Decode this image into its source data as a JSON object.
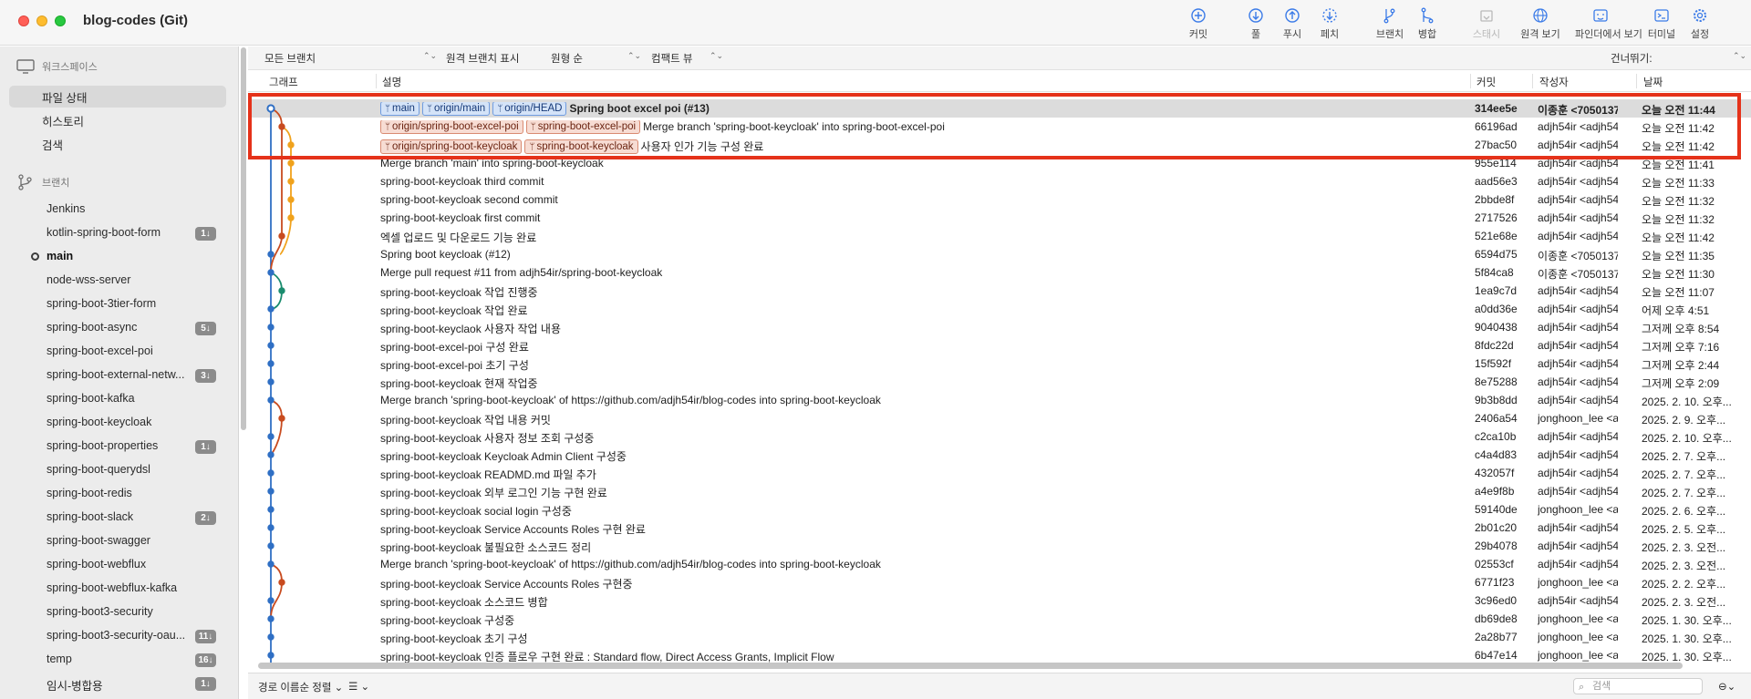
{
  "window": {
    "title": "blog-codes (Git)"
  },
  "toolbar": [
    {
      "label": "커밋",
      "icon": "plus-circle-icon",
      "disabled": false
    },
    {
      "label": "풀",
      "icon": "arrow-down-circle-icon",
      "disabled": false
    },
    {
      "label": "푸시",
      "icon": "arrow-up-circle-icon",
      "disabled": false
    },
    {
      "label": "페치",
      "icon": "arrow-down-dashed-circle-icon",
      "disabled": false
    },
    {
      "label": "브랜치",
      "icon": "branch-icon",
      "disabled": false
    },
    {
      "label": "병합",
      "icon": "merge-icon",
      "disabled": false
    },
    {
      "label": "스태시",
      "icon": "stash-icon",
      "disabled": true
    },
    {
      "label": "원격 보기",
      "icon": "globe-icon",
      "disabled": false
    },
    {
      "label": "파인더에서 보기",
      "icon": "finder-icon",
      "disabled": false
    },
    {
      "label": "터미널",
      "icon": "terminal-icon",
      "disabled": false
    },
    {
      "label": "설정",
      "icon": "gear-icon",
      "disabled": false
    }
  ],
  "sidebar": {
    "workspace_label": "워크스페이스",
    "workspace_items": [
      "파일 상태",
      "히스토리",
      "검색"
    ],
    "branches_label": "브랜치",
    "branches": [
      {
        "name": "Jenkins",
        "badge": ""
      },
      {
        "name": "kotlin-spring-boot-form",
        "badge": "1↓"
      },
      {
        "name": "main",
        "badge": "",
        "current": true
      },
      {
        "name": "node-wss-server",
        "badge": ""
      },
      {
        "name": "spring-boot-3tier-form",
        "badge": ""
      },
      {
        "name": "spring-boot-async",
        "badge": "5↓"
      },
      {
        "name": "spring-boot-excel-poi",
        "badge": ""
      },
      {
        "name": "spring-boot-external-netw...",
        "badge": "3↓"
      },
      {
        "name": "spring-boot-kafka",
        "badge": ""
      },
      {
        "name": "spring-boot-keycloak",
        "badge": ""
      },
      {
        "name": "spring-boot-properties",
        "badge": "1↓"
      },
      {
        "name": "spring-boot-querydsl",
        "badge": ""
      },
      {
        "name": "spring-boot-redis",
        "badge": ""
      },
      {
        "name": "spring-boot-slack",
        "badge": "2↓"
      },
      {
        "name": "spring-boot-swagger",
        "badge": ""
      },
      {
        "name": "spring-boot-webflux",
        "badge": ""
      },
      {
        "name": "spring-boot-webflux-kafka",
        "badge": ""
      },
      {
        "name": "spring-boot3-security",
        "badge": ""
      },
      {
        "name": "spring-boot3-security-oau...",
        "badge": "11↓"
      },
      {
        "name": "temp",
        "badge": "16↓"
      },
      {
        "name": "임시-병합용",
        "badge": "1↓"
      }
    ]
  },
  "filters": {
    "branches": "모든 브랜치",
    "remote": "원격 브랜치 표시",
    "order": "원형 순",
    "view": "컴팩트 뷰",
    "skip": "건너뛰기:"
  },
  "columns": {
    "graph": "그래프",
    "desc": "설명",
    "commit": "커밋",
    "author": "작성자",
    "date": "날짜"
  },
  "commits": [
    {
      "tags": [
        [
          "blue",
          "main"
        ],
        [
          "blue",
          "origin/main"
        ],
        [
          "blue",
          "origin/HEAD"
        ]
      ],
      "desc": "Spring boot excel poi (#13)",
      "hash": "314ee5e",
      "author": "이종훈 <7050137...",
      "date": "오늘 오전 11:44",
      "bold": true,
      "selected": true
    },
    {
      "tags": [
        [
          "red",
          "origin/spring-boot-excel-poi"
        ],
        [
          "red",
          "spring-boot-excel-poi"
        ]
      ],
      "desc": "Merge branch 'spring-boot-keycloak' into spring-boot-excel-poi",
      "hash": "66196ad",
      "author": "adjh54ir <adjh54...",
      "date": "오늘 오전 11:42"
    },
    {
      "tags": [
        [
          "red",
          "origin/spring-boot-keycloak"
        ],
        [
          "red",
          "spring-boot-keycloak"
        ]
      ],
      "desc": "사용자 인가 기능 구성 완료",
      "hash": "27bac50",
      "author": "adjh54ir <adjh54...",
      "date": "오늘 오전 11:42"
    },
    {
      "tags": [],
      "desc": "Merge branch 'main' into spring-boot-keycloak",
      "hash": "955e114",
      "author": "adjh54ir <adjh54...",
      "date": "오늘 오전 11:41"
    },
    {
      "tags": [],
      "desc": "spring-boot-keycloak third commit",
      "hash": "aad56e3",
      "author": "adjh54ir <adjh54...",
      "date": "오늘 오전 11:33"
    },
    {
      "tags": [],
      "desc": "spring-boot-keycloak second commit",
      "hash": "2bbde8f",
      "author": "adjh54ir <adjh54...",
      "date": "오늘 오전 11:32"
    },
    {
      "tags": [],
      "desc": "spring-boot-keycloak first commit",
      "hash": "2717526",
      "author": "adjh54ir <adjh54...",
      "date": "오늘 오전 11:32"
    },
    {
      "tags": [],
      "desc": "엑셀 업로드 및 다운로드 기능 완료",
      "hash": "521e68e",
      "author": "adjh54ir <adjh54...",
      "date": "오늘 오전 11:42"
    },
    {
      "tags": [],
      "desc": "Spring boot keycloak (#12)",
      "hash": "6594d75",
      "author": "이종훈 <7050137...",
      "date": "오늘 오전 11:35"
    },
    {
      "tags": [],
      "desc": "Merge pull request #11 from adjh54ir/spring-boot-keycloak",
      "hash": "5f84ca8",
      "author": "이종훈 <7050137...",
      "date": "오늘 오전 11:30"
    },
    {
      "tags": [],
      "desc": "spring-boot-keycloak 작업 진행중",
      "hash": "1ea9c7d",
      "author": "adjh54ir <adjh54...",
      "date": "오늘 오전 11:07"
    },
    {
      "tags": [],
      "desc": "spring-boot-keycloak 작업 완료",
      "hash": "a0dd36e",
      "author": "adjh54ir <adjh54...",
      "date": "어제 오후 4:51"
    },
    {
      "tags": [],
      "desc": "spring-boot-keyclaok 사용자 작업 내용",
      "hash": "9040438",
      "author": "adjh54ir <adjh54...",
      "date": "그저께 오후 8:54"
    },
    {
      "tags": [],
      "desc": "spring-boot-excel-poi 구성 완료",
      "hash": "8fdc22d",
      "author": "adjh54ir <adjh54...",
      "date": "그저께 오후 7:16"
    },
    {
      "tags": [],
      "desc": "spring-boot-excel-poi 초기 구성",
      "hash": "15f592f",
      "author": "adjh54ir <adjh54...",
      "date": "그저께 오후 2:44"
    },
    {
      "tags": [],
      "desc": "spring-boot-keycloak 현재 작업중",
      "hash": "8e75288",
      "author": "adjh54ir <adjh54...",
      "date": "그저께 오후 2:09"
    },
    {
      "tags": [],
      "desc": "Merge branch 'spring-boot-keycloak' of https://github.com/adjh54ir/blog-codes into spring-boot-keycloak",
      "hash": "9b3b8dd",
      "author": "adjh54ir <adjh54...",
      "date": "2025. 2. 10. 오후..."
    },
    {
      "tags": [],
      "desc": "spring-boot-keycloak 작업 내용 커밋",
      "hash": "2406a54",
      "author": "jonghoon_lee <a...",
      "date": "2025. 2. 9. 오후..."
    },
    {
      "tags": [],
      "desc": "spring-boot-keycloak 사용자 정보 조회 구성중",
      "hash": "c2ca10b",
      "author": "adjh54ir <adjh54...",
      "date": "2025. 2. 10. 오후..."
    },
    {
      "tags": [],
      "desc": "spring-boot-keycloak Keycloak Admin Client 구성중",
      "hash": "c4a4d83",
      "author": "adjh54ir <adjh54...",
      "date": "2025. 2. 7. 오후..."
    },
    {
      "tags": [],
      "desc": "spring-boot-keycloak READMD.md 파일 추가",
      "hash": "432057f",
      "author": "adjh54ir <adjh54...",
      "date": "2025. 2. 7. 오후..."
    },
    {
      "tags": [],
      "desc": "spring-boot-keycloak 외부 로그인 기능 구현 완료",
      "hash": "a4e9f8b",
      "author": "adjh54ir <adjh54...",
      "date": "2025. 2. 7. 오후..."
    },
    {
      "tags": [],
      "desc": "spring-boot-keycloak social login 구성중",
      "hash": "59140de",
      "author": "jonghoon_lee <a...",
      "date": "2025. 2. 6. 오후..."
    },
    {
      "tags": [],
      "desc": "spring-boot-keycloak Service Accounts Roles 구현 완료",
      "hash": "2b01c20",
      "author": "adjh54ir <adjh54...",
      "date": "2025. 2. 5. 오후..."
    },
    {
      "tags": [],
      "desc": "spring-boot-keycloak 불필요한 소스코드 정리",
      "hash": "29b4078",
      "author": "adjh54ir <adjh54...",
      "date": "2025. 2. 3. 오전..."
    },
    {
      "tags": [],
      "desc": "Merge branch 'spring-boot-keycloak' of https://github.com/adjh54ir/blog-codes into spring-boot-keycloak",
      "hash": "02553cf",
      "author": "adjh54ir <adjh54...",
      "date": "2025. 2. 3. 오전..."
    },
    {
      "tags": [],
      "desc": "spring-boot-keycloak Service Accounts Roles 구현중",
      "hash": "6771f23",
      "author": "jonghoon_lee <a...",
      "date": "2025. 2. 2. 오후..."
    },
    {
      "tags": [],
      "desc": "spring-boot-keycloak 소스코드 병합",
      "hash": "3c96ed0",
      "author": "adjh54ir <adjh54...",
      "date": "2025. 2. 3. 오전..."
    },
    {
      "tags": [],
      "desc": "spring-boot-keycloak 구성중",
      "hash": "db69de8",
      "author": "jonghoon_lee <a...",
      "date": "2025. 1. 30. 오후..."
    },
    {
      "tags": [],
      "desc": "spring-boot-keycloak 초기 구성",
      "hash": "2a28b77",
      "author": "jonghoon_lee <a...",
      "date": "2025. 1. 30. 오후..."
    },
    {
      "tags": [],
      "desc": "spring-boot-keycloak 인증 플로우 구현 완료 : Standard flow, Direct Access Grants, Implicit Flow",
      "hash": "6b47e14",
      "author": "jonghoon_lee <a...",
      "date": "2025. 1. 30. 오후..."
    }
  ],
  "bottombar": {
    "sort": "경로 이름순 정렬",
    "search_placeholder": "검색"
  },
  "colors": {
    "lane_main": "#2f6fc4",
    "lane_excel": "#c84b1f",
    "lane_keycloak": "#f0a21c",
    "lane_teal": "#1a8c6e",
    "highlight": "#e5321a"
  }
}
